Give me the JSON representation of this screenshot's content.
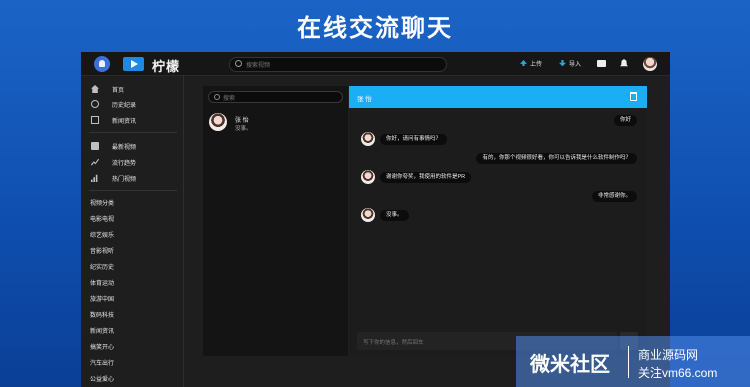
{
  "banner": {
    "title": "在线交流聊天"
  },
  "app": {
    "logo_text": "柠檬",
    "search_placeholder": "搜索视频",
    "upload_label": "上传",
    "import_label": "导入"
  },
  "sidebar": {
    "main_items": [
      {
        "label": "首页",
        "icon": "home-icon"
      },
      {
        "label": "历史纪录",
        "icon": "history-icon"
      },
      {
        "label": "新闻资讯",
        "icon": "news-icon"
      }
    ],
    "video_items": [
      {
        "label": "最新视频",
        "icon": "video-icon"
      },
      {
        "label": "流行趋势",
        "icon": "trend-icon"
      },
      {
        "label": "热门视频",
        "icon": "hot-icon"
      }
    ],
    "categories": [
      "视频分类",
      "电影电视",
      "综艺娱乐",
      "音影视听",
      "纪实历史",
      "体育运动",
      "旅游中国",
      "数码科技",
      "新闻资讯",
      "搞笑开心",
      "汽车出行",
      "公益爱心"
    ]
  },
  "contacts": {
    "search_placeholder": "搜索",
    "list": [
      {
        "name": "张 怡",
        "preview": "没事。"
      }
    ]
  },
  "chat": {
    "header_name": "张 怡",
    "messages": [
      {
        "from": "me",
        "text": "你好"
      },
      {
        "from": "them",
        "text": "你好，请问有事情吗？"
      },
      {
        "from": "me",
        "text": "有的，你那个视频很好看，你可以告诉我是什么软件制作吗？"
      },
      {
        "from": "them",
        "text": "谢谢你夸奖，我使用的软件是PR"
      },
      {
        "from": "me",
        "text": "非常感谢你。"
      },
      {
        "from": "them",
        "text": "没事。"
      }
    ],
    "composer_placeholder": "写下你的信息，然后回车"
  },
  "watermark": {
    "big": "微米社区",
    "line1": "商业源码网",
    "line2": "关注vm66.com"
  }
}
